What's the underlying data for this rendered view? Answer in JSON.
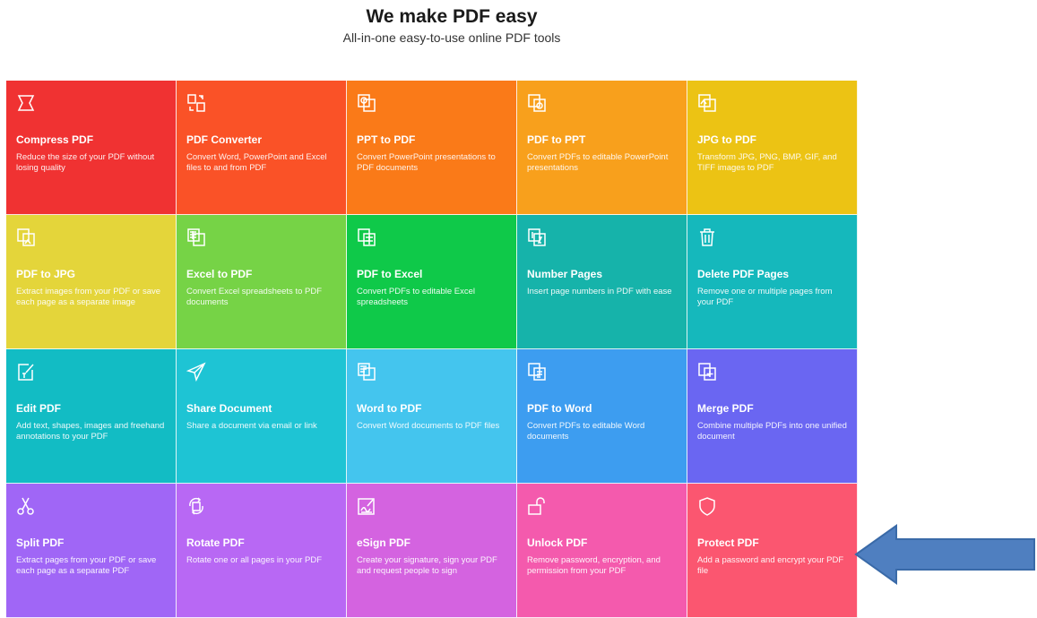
{
  "header": {
    "title": "We make PDF easy",
    "subtitle": "All-in-one easy-to-use online PDF tools"
  },
  "tools": [
    {
      "title": "Compress PDF",
      "desc": "Reduce the size of your PDF without losing quality",
      "color": "#f03232",
      "icon": "compress-icon"
    },
    {
      "title": "PDF Converter",
      "desc": "Convert Word, PowerPoint and Excel files to and from PDF",
      "color": "#fa5227",
      "icon": "convert-icon"
    },
    {
      "title": "PPT to PDF",
      "desc": "Convert PowerPoint presentations to PDF documents",
      "color": "#fa7a18",
      "icon": "ppt-icon"
    },
    {
      "title": "PDF to PPT",
      "desc": "Convert PDFs to editable PowerPoint presentations",
      "color": "#f8a01c",
      "icon": "pdf-to-ppt-icon"
    },
    {
      "title": "JPG to PDF",
      "desc": "Transform JPG, PNG, BMP, GIF, and TIFF images to PDF",
      "color": "#ecc314",
      "icon": "image-icon"
    },
    {
      "title": "PDF to JPG",
      "desc": "Extract images from your PDF or save each page as a separate image",
      "color": "#e4d53a",
      "icon": "pdf-to-image-icon"
    },
    {
      "title": "Excel to PDF",
      "desc": "Convert Excel spreadsheets to PDF documents",
      "color": "#76d346",
      "icon": "excel-icon"
    },
    {
      "title": "PDF to Excel",
      "desc": "Convert PDFs to editable Excel spreadsheets",
      "color": "#0fc949",
      "icon": "pdf-to-excel-icon"
    },
    {
      "title": "Number Pages",
      "desc": "Insert page numbers in PDF with ease",
      "color": "#16b3aa",
      "icon": "number-pages-icon"
    },
    {
      "title": "Delete PDF Pages",
      "desc": "Remove one or multiple pages from your PDF",
      "color": "#15b8bc",
      "icon": "trash-icon"
    },
    {
      "title": "Edit PDF",
      "desc": "Add text, shapes, images and freehand annotations to your PDF",
      "color": "#12bcc4",
      "icon": "edit-icon"
    },
    {
      "title": "Share Document",
      "desc": "Share a document via email or link",
      "color": "#1ec4d4",
      "icon": "send-icon"
    },
    {
      "title": "Word to PDF",
      "desc": "Convert Word documents to PDF files",
      "color": "#44c5ee",
      "icon": "word-icon"
    },
    {
      "title": "PDF to Word",
      "desc": "Convert PDFs to editable Word documents",
      "color": "#3d9df0",
      "icon": "pdf-to-word-icon"
    },
    {
      "title": "Merge PDF",
      "desc": "Combine multiple PDFs into one unified document",
      "color": "#6a66f2",
      "icon": "merge-icon"
    },
    {
      "title": "Split PDF",
      "desc": "Extract pages from your PDF or save each page as a separate PDF",
      "color": "#a066f6",
      "icon": "scissors-icon"
    },
    {
      "title": "Rotate PDF",
      "desc": "Rotate one or all pages in your PDF",
      "color": "#b868f4",
      "icon": "rotate-icon"
    },
    {
      "title": "eSign PDF",
      "desc": "Create your signature, sign your PDF and request people to sign",
      "color": "#d463e0",
      "icon": "signature-icon"
    },
    {
      "title": "Unlock PDF",
      "desc": "Remove password, encryption, and permission from your PDF",
      "color": "#f45aad",
      "icon": "unlock-icon"
    },
    {
      "title": "Protect PDF",
      "desc": "Add a password and encrypt your PDF file",
      "color": "#fb5670",
      "icon": "shield-icon"
    }
  ],
  "arrow_color": "#4f7fc0"
}
